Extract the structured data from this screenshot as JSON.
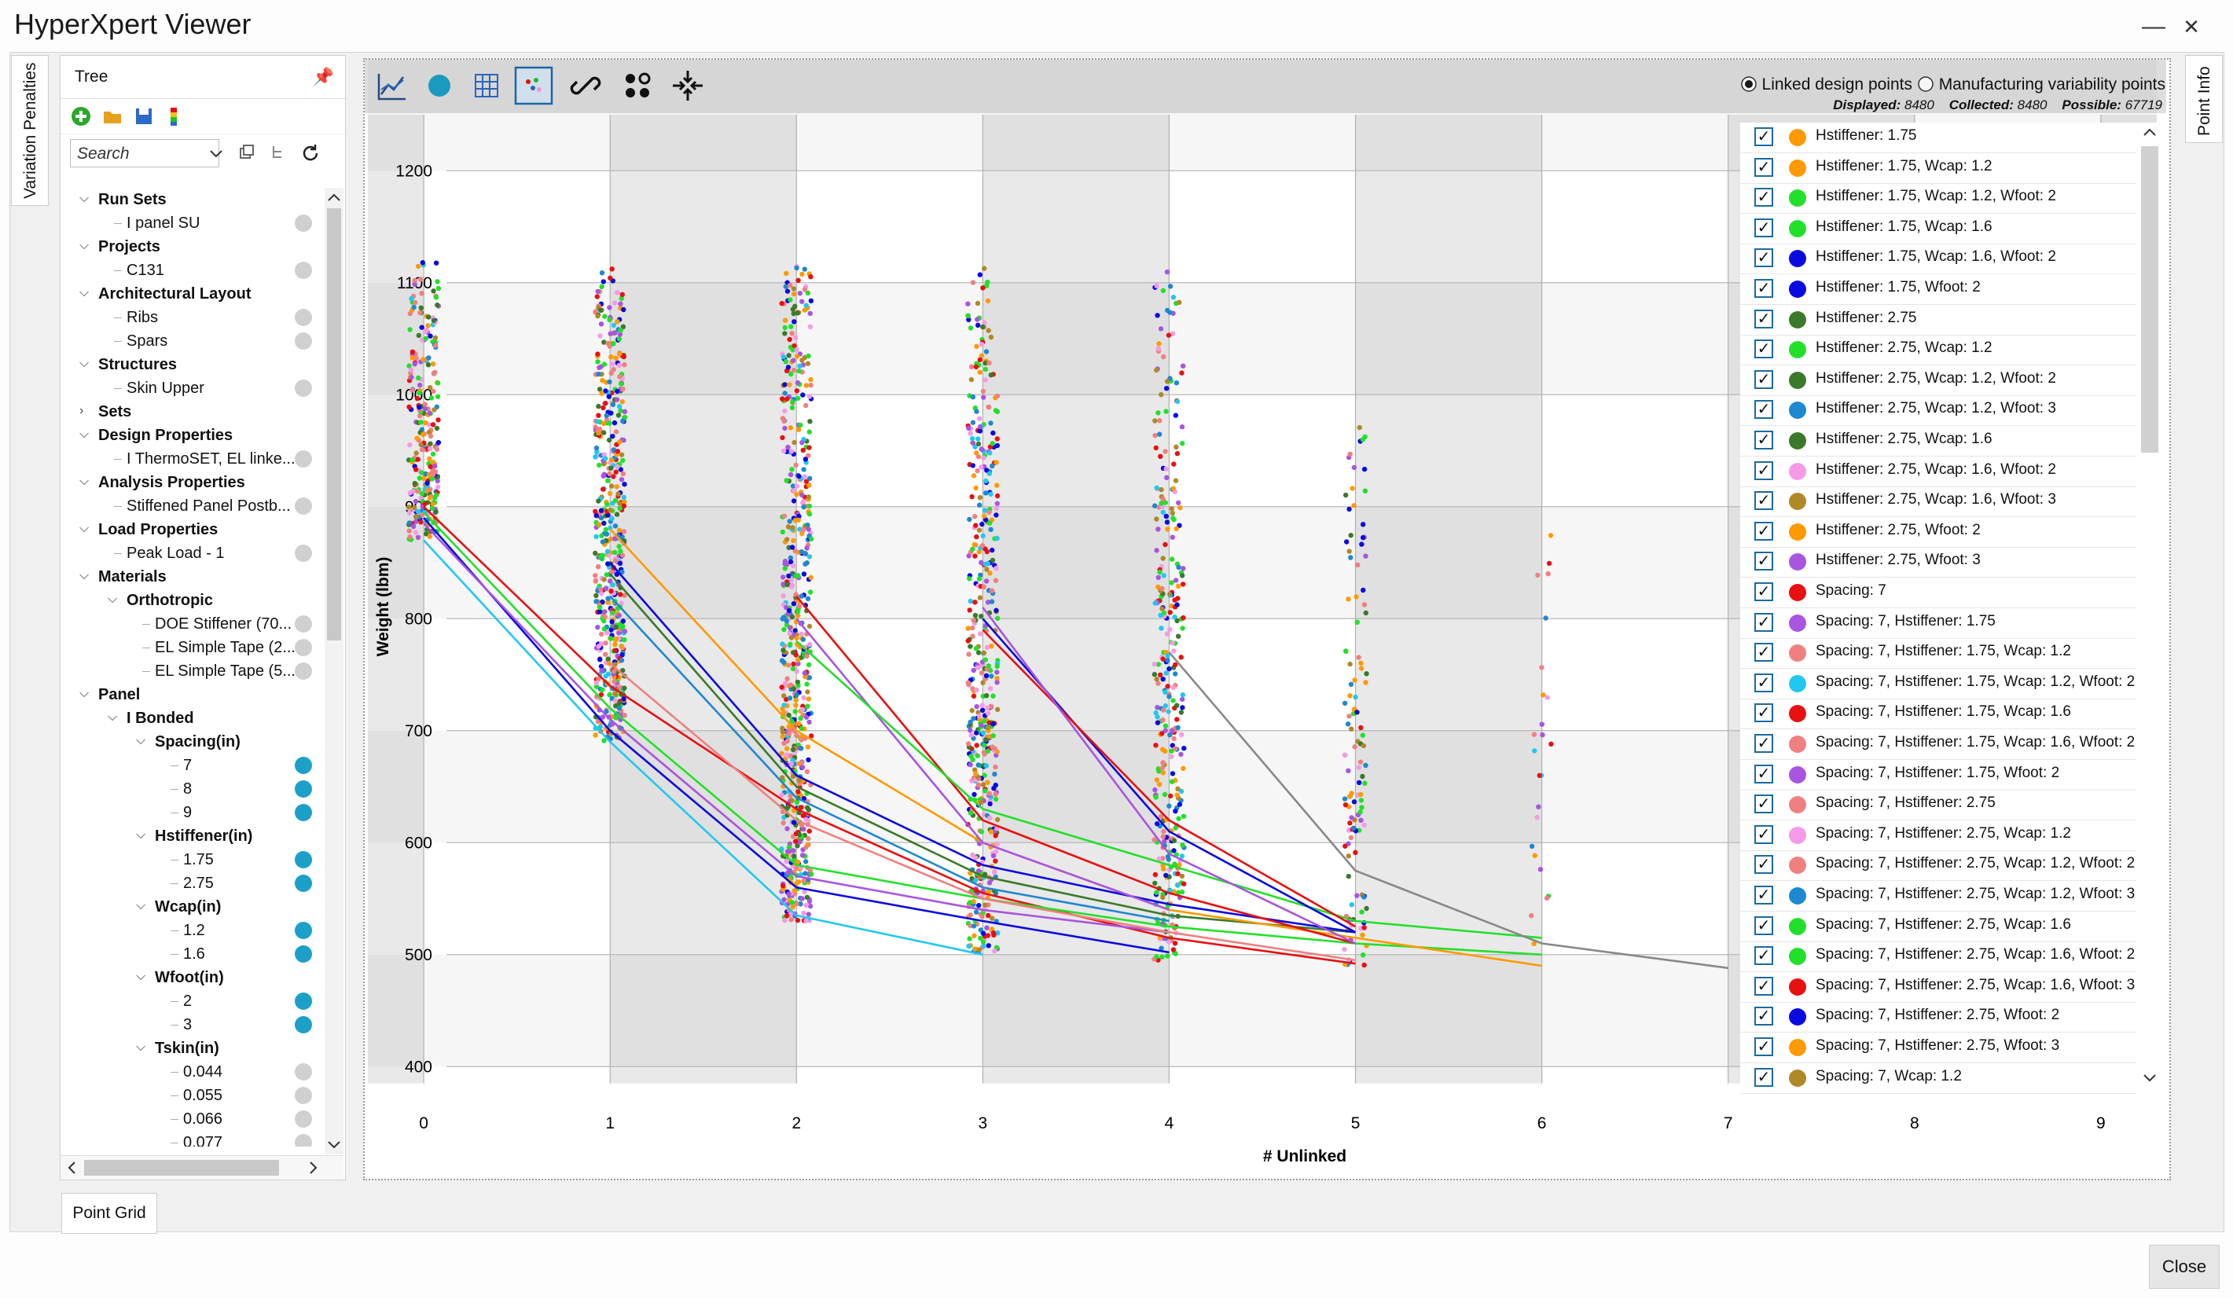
{
  "window": {
    "title": "HyperXpert Viewer",
    "minimize": "—",
    "maximize": "□",
    "close": "✕"
  },
  "side_tabs": {
    "left": "Variation Penalties",
    "right": "Point Info"
  },
  "tree": {
    "header": "Tree",
    "search_placeholder": "Search",
    "items": [
      {
        "label": "Run Sets",
        "bold": true,
        "indent": 0,
        "exp": "v"
      },
      {
        "label": "I panel SU",
        "indent": 1,
        "dot": "#d0d0d0"
      },
      {
        "label": "Projects",
        "bold": true,
        "indent": 0,
        "exp": "v"
      },
      {
        "label": "C131",
        "indent": 1,
        "dot": "#d0d0d0"
      },
      {
        "label": "Architectural Layout",
        "bold": true,
        "indent": 0,
        "exp": "v"
      },
      {
        "label": "Ribs",
        "indent": 1,
        "dot": "#d0d0d0"
      },
      {
        "label": "Spars",
        "indent": 1,
        "dot": "#d0d0d0"
      },
      {
        "label": "Structures",
        "bold": true,
        "indent": 0,
        "exp": "v"
      },
      {
        "label": "Skin Upper",
        "indent": 1,
        "dot": "#d0d0d0"
      },
      {
        "label": "Sets",
        "bold": true,
        "indent": 0,
        "exp": ">"
      },
      {
        "label": "Design Properties",
        "bold": true,
        "indent": 0,
        "exp": "v"
      },
      {
        "label": "I ThermoSET, EL linke...",
        "indent": 1,
        "dot": "#d0d0d0"
      },
      {
        "label": "Analysis Properties",
        "bold": true,
        "indent": 0,
        "exp": "v"
      },
      {
        "label": "Stiffened Panel Postb...",
        "indent": 1,
        "dot": "#d0d0d0"
      },
      {
        "label": "Load Properties",
        "bold": true,
        "indent": 0,
        "exp": "v"
      },
      {
        "label": "Peak Load - 1",
        "indent": 1,
        "dot": "#d0d0d0"
      },
      {
        "label": "Materials",
        "bold": true,
        "indent": 0,
        "exp": "v"
      },
      {
        "label": "Orthotropic",
        "bold": true,
        "indent": 1,
        "exp": "v"
      },
      {
        "label": "DOE Stiffener (70...",
        "indent": 2,
        "dot": "#d0d0d0"
      },
      {
        "label": "EL Simple Tape (2...",
        "indent": 2,
        "dot": "#d0d0d0"
      },
      {
        "label": "EL Simple Tape (5...",
        "indent": 2,
        "dot": "#d0d0d0"
      },
      {
        "label": "Panel",
        "bold": true,
        "indent": 0,
        "exp": "v"
      },
      {
        "label": "I Bonded",
        "bold": true,
        "indent": 1,
        "exp": "v"
      },
      {
        "label": "Spacing(in)",
        "bold": true,
        "indent": 2,
        "exp": "v"
      },
      {
        "label": "7",
        "indent": 3,
        "dot": "#1ca0c8"
      },
      {
        "label": "8",
        "indent": 3,
        "dot": "#1ca0c8"
      },
      {
        "label": "9",
        "indent": 3,
        "dot": "#1ca0c8"
      },
      {
        "label": "Hstiffener(in)",
        "bold": true,
        "indent": 2,
        "exp": "v"
      },
      {
        "label": "1.75",
        "indent": 3,
        "dot": "#1ca0c8"
      },
      {
        "label": "2.75",
        "indent": 3,
        "dot": "#1ca0c8"
      },
      {
        "label": "Wcap(in)",
        "bold": true,
        "indent": 2,
        "exp": "v"
      },
      {
        "label": "1.2",
        "indent": 3,
        "dot": "#1ca0c8"
      },
      {
        "label": "1.6",
        "indent": 3,
        "dot": "#1ca0c8"
      },
      {
        "label": "Wfoot(in)",
        "bold": true,
        "indent": 2,
        "exp": "v"
      },
      {
        "label": "2",
        "indent": 3,
        "dot": "#1ca0c8"
      },
      {
        "label": "3",
        "indent": 3,
        "dot": "#1ca0c8"
      },
      {
        "label": "Tskin(in)",
        "bold": true,
        "indent": 2,
        "exp": "v"
      },
      {
        "label": "0.044",
        "indent": 3,
        "dot": "#d0d0d0"
      },
      {
        "label": "0.055",
        "indent": 3,
        "dot": "#d0d0d0"
      },
      {
        "label": "0.066",
        "indent": 3,
        "dot": "#d0d0d0"
      },
      {
        "label": "0.077",
        "indent": 3,
        "dot": "#d0d0d0"
      }
    ]
  },
  "point_grid_tab": "Point Grid",
  "close_button": "Close",
  "plot_header": {
    "radio_linked": "Linked design points",
    "radio_mfg": "Manufacturing variability points",
    "displayed_label": "Displayed:",
    "displayed": "8480",
    "collected_label": "Collected:",
    "collected": "8480",
    "possible_label": "Possible:",
    "possible": "67719"
  },
  "legend": [
    {
      "text": "Hstiffener: 1.75",
      "color": "#ff9a00"
    },
    {
      "text": "Hstiffener: 1.75, Wcap: 1.2",
      "color": "#ff9a00"
    },
    {
      "text": "Hstiffener: 1.75, Wcap: 1.2, Wfoot: 2",
      "color": "#22e02a"
    },
    {
      "text": "Hstiffener: 1.75, Wcap: 1.6",
      "color": "#22e02a"
    },
    {
      "text": "Hstiffener: 1.75, Wcap: 1.6, Wfoot: 2",
      "color": "#0a0ae0"
    },
    {
      "text": "Hstiffener: 1.75, Wfoot: 2",
      "color": "#0a0ae0"
    },
    {
      "text": "Hstiffener: 2.75",
      "color": "#3a7a2a"
    },
    {
      "text": "Hstiffener: 2.75, Wcap: 1.2",
      "color": "#22e02a"
    },
    {
      "text": "Hstiffener: 2.75, Wcap: 1.2, Wfoot: 2",
      "color": "#3a7a2a"
    },
    {
      "text": "Hstiffener: 2.75, Wcap: 1.2, Wfoot: 3",
      "color": "#1e88d0"
    },
    {
      "text": "Hstiffener: 2.75, Wcap: 1.6",
      "color": "#3a7a2a"
    },
    {
      "text": "Hstiffener: 2.75, Wcap: 1.6, Wfoot: 2",
      "color": "#f59ae8"
    },
    {
      "text": "Hstiffener: 2.75, Wcap: 1.6, Wfoot: 3",
      "color": "#b08828"
    },
    {
      "text": "Hstiffener: 2.75, Wfoot: 2",
      "color": "#ff9a00"
    },
    {
      "text": "Hstiffener: 2.75, Wfoot: 3",
      "color": "#a855e0"
    },
    {
      "text": "Spacing: 7",
      "color": "#e81010"
    },
    {
      "text": "Spacing: 7, Hstiffener: 1.75",
      "color": "#a855e0"
    },
    {
      "text": "Spacing: 7, Hstiffener: 1.75, Wcap: 1.2",
      "color": "#f08080"
    },
    {
      "text": "Spacing: 7, Hstiffener: 1.75, Wcap: 1.2, Wfoot: 2",
      "color": "#20c8f0"
    },
    {
      "text": "Spacing: 7, Hstiffener: 1.75, Wcap: 1.6",
      "color": "#e81010"
    },
    {
      "text": "Spacing: 7, Hstiffener: 1.75, Wcap: 1.6, Wfoot: 2",
      "color": "#f08080"
    },
    {
      "text": "Spacing: 7, Hstiffener: 1.75, Wfoot: 2",
      "color": "#a855e0"
    },
    {
      "text": "Spacing: 7, Hstiffener: 2.75",
      "color": "#f08080"
    },
    {
      "text": "Spacing: 7, Hstiffener: 2.75, Wcap: 1.2",
      "color": "#f59ae8"
    },
    {
      "text": "Spacing: 7, Hstiffener: 2.75, Wcap: 1.2, Wfoot: 2",
      "color": "#f08080"
    },
    {
      "text": "Spacing: 7, Hstiffener: 2.75, Wcap: 1.2, Wfoot: 3",
      "color": "#1e88d0"
    },
    {
      "text": "Spacing: 7, Hstiffener: 2.75, Wcap: 1.6",
      "color": "#22e02a"
    },
    {
      "text": "Spacing: 7, Hstiffener: 2.75, Wcap: 1.6, Wfoot: 2",
      "color": "#22e02a"
    },
    {
      "text": "Spacing: 7, Hstiffener: 2.75, Wcap: 1.6, Wfoot: 3",
      "color": "#e81010"
    },
    {
      "text": "Spacing: 7, Hstiffener: 2.75, Wfoot: 2",
      "color": "#0a0ae0"
    },
    {
      "text": "Spacing: 7, Hstiffener: 2.75, Wfoot: 3",
      "color": "#ff9a00"
    },
    {
      "text": "Spacing: 7, Wcap: 1.2",
      "color": "#b08828"
    }
  ],
  "chart_data": {
    "type": "scatter",
    "xlabel": "# Unlinked",
    "ylabel": "Weight (lbm)",
    "x_ticks": [
      0,
      1,
      2,
      3,
      4,
      5,
      6,
      7,
      8,
      9
    ],
    "y_ticks": [
      400,
      500,
      600,
      700,
      800,
      900,
      1000,
      1100,
      1200
    ],
    "xlim": [
      -0.3,
      9.3
    ],
    "ylim": [
      370,
      1250
    ],
    "grid": true,
    "scatter_columns": [
      {
        "x": 0,
        "ymin": 870,
        "ymax": 1120
      },
      {
        "x": 1,
        "ymin": 690,
        "ymax": 1120
      },
      {
        "x": 2,
        "ymin": 530,
        "ymax": 1120
      },
      {
        "x": 3,
        "ymin": 500,
        "ymax": 1120
      },
      {
        "x": 4,
        "ymin": 495,
        "ymax": 1110
      },
      {
        "x": 5,
        "ymin": 490,
        "ymax": 1005
      },
      {
        "x": 6,
        "ymin": 490,
        "ymax": 880
      }
    ],
    "series": [
      {
        "color": "#e81010",
        "x": [
          0,
          1,
          2,
          3,
          4,
          5
        ],
        "y": [
          900,
          740,
          630,
          555,
          515,
          492
        ]
      },
      {
        "color": "#0a0ae0",
        "x": [
          0,
          1,
          2,
          3,
          4
        ],
        "y": [
          890,
          700,
          560,
          530,
          502
        ]
      },
      {
        "color": "#20c8f0",
        "x": [
          0,
          1,
          2,
          3
        ],
        "y": [
          870,
          690,
          535,
          500
        ]
      },
      {
        "color": "#22e02a",
        "x": [
          0,
          1,
          2,
          3,
          4,
          5,
          6
        ],
        "y": [
          895,
          720,
          580,
          550,
          525,
          510,
          500
        ]
      },
      {
        "color": "#a855e0",
        "x": [
          0,
          1,
          2,
          3,
          4
        ],
        "y": [
          885,
          710,
          570,
          540,
          520
        ]
      },
      {
        "color": "#f08080",
        "x": [
          1,
          2,
          3,
          4,
          5
        ],
        "y": [
          760,
          620,
          550,
          520,
          495
        ]
      },
      {
        "color": "#3a7a2a",
        "x": [
          1,
          2,
          3,
          4,
          5
        ],
        "y": [
          840,
          650,
          570,
          535,
          520
        ]
      },
      {
        "color": "#1e88d0",
        "x": [
          1,
          2,
          3,
          4
        ],
        "y": [
          820,
          640,
          560,
          530
        ]
      },
      {
        "color": "#ff9a00",
        "x": [
          1,
          2,
          3,
          4,
          5,
          6
        ],
        "y": [
          880,
          700,
          600,
          540,
          515,
          490
        ]
      },
      {
        "color": "#0a0ae0",
        "x": [
          1,
          2,
          3,
          4,
          5
        ],
        "y": [
          850,
          660,
          580,
          545,
          520
        ]
      },
      {
        "color": "#e81010",
        "x": [
          2,
          3,
          4,
          5
        ],
        "y": [
          820,
          620,
          555,
          510
        ]
      },
      {
        "color": "#a855e0",
        "x": [
          2,
          3,
          4
        ],
        "y": [
          800,
          600,
          540
        ]
      },
      {
        "color": "#22e02a",
        "x": [
          2,
          3,
          4,
          5,
          6
        ],
        "y": [
          780,
          630,
          580,
          530,
          515
        ]
      },
      {
        "color": "#0a0ae0",
        "x": [
          3,
          4,
          5
        ],
        "y": [
          800,
          610,
          520
        ]
      },
      {
        "color": "#e81010",
        "x": [
          3,
          4,
          5
        ],
        "y": [
          790,
          620,
          525
        ]
      },
      {
        "color": "#a855e0",
        "x": [
          3,
          4,
          5
        ],
        "y": [
          810,
          590,
          510
        ]
      },
      {
        "color": "#888888",
        "x": [
          4,
          5,
          6,
          7
        ],
        "y": [
          770,
          575,
          510,
          488
        ]
      }
    ]
  }
}
